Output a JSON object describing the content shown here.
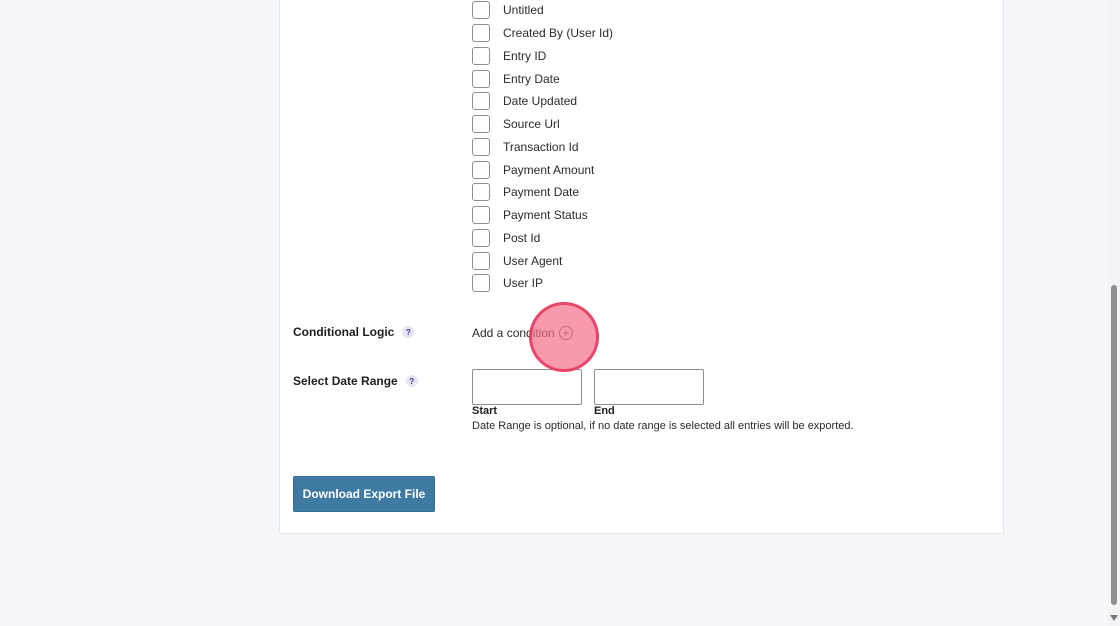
{
  "fields": [
    {
      "label": "Untitled",
      "checked": false
    },
    {
      "label": "Created By (User Id)",
      "checked": false
    },
    {
      "label": "Entry ID",
      "checked": false
    },
    {
      "label": "Entry Date",
      "checked": false
    },
    {
      "label": "Date Updated",
      "checked": false
    },
    {
      "label": "Source Url",
      "checked": false
    },
    {
      "label": "Transaction Id",
      "checked": false
    },
    {
      "label": "Payment Amount",
      "checked": false
    },
    {
      "label": "Payment Date",
      "checked": false
    },
    {
      "label": "Payment Status",
      "checked": false
    },
    {
      "label": "Post Id",
      "checked": false
    },
    {
      "label": "User Agent",
      "checked": false
    },
    {
      "label": "User IP",
      "checked": false
    }
  ],
  "conditional_logic": {
    "label": "Conditional Logic",
    "help": "?",
    "add_label": "Add a condition"
  },
  "date_range": {
    "label": "Select Date Range",
    "help": "?",
    "start_caption": "Start",
    "end_caption": "End",
    "start_value": "",
    "end_value": "",
    "note": "Date Range is optional, if no date range is selected all entries will be exported."
  },
  "download_label": "Download Export File",
  "colors": {
    "primary_button": "#3f7aa3",
    "click_marker": "#f46987",
    "background": "#f5f7fa"
  }
}
